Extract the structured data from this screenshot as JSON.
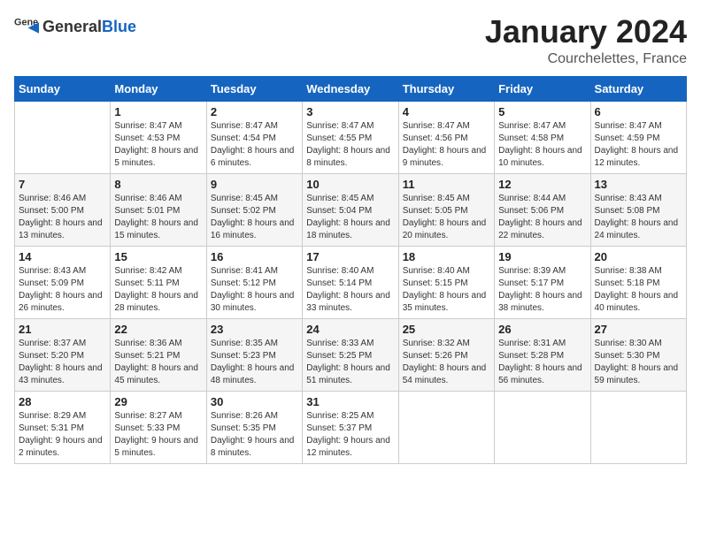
{
  "logo": {
    "general": "General",
    "blue": "Blue"
  },
  "title": {
    "month": "January 2024",
    "location": "Courchelettes, France"
  },
  "days_of_week": [
    "Sunday",
    "Monday",
    "Tuesday",
    "Wednesday",
    "Thursday",
    "Friday",
    "Saturday"
  ],
  "weeks": [
    [
      {
        "day": "",
        "sunrise": "",
        "sunset": "",
        "daylight": ""
      },
      {
        "day": "1",
        "sunrise": "Sunrise: 8:47 AM",
        "sunset": "Sunset: 4:53 PM",
        "daylight": "Daylight: 8 hours and 5 minutes."
      },
      {
        "day": "2",
        "sunrise": "Sunrise: 8:47 AM",
        "sunset": "Sunset: 4:54 PM",
        "daylight": "Daylight: 8 hours and 6 minutes."
      },
      {
        "day": "3",
        "sunrise": "Sunrise: 8:47 AM",
        "sunset": "Sunset: 4:55 PM",
        "daylight": "Daylight: 8 hours and 8 minutes."
      },
      {
        "day": "4",
        "sunrise": "Sunrise: 8:47 AM",
        "sunset": "Sunset: 4:56 PM",
        "daylight": "Daylight: 8 hours and 9 minutes."
      },
      {
        "day": "5",
        "sunrise": "Sunrise: 8:47 AM",
        "sunset": "Sunset: 4:58 PM",
        "daylight": "Daylight: 8 hours and 10 minutes."
      },
      {
        "day": "6",
        "sunrise": "Sunrise: 8:47 AM",
        "sunset": "Sunset: 4:59 PM",
        "daylight": "Daylight: 8 hours and 12 minutes."
      }
    ],
    [
      {
        "day": "7",
        "sunrise": "Sunrise: 8:46 AM",
        "sunset": "Sunset: 5:00 PM",
        "daylight": "Daylight: 8 hours and 13 minutes."
      },
      {
        "day": "8",
        "sunrise": "Sunrise: 8:46 AM",
        "sunset": "Sunset: 5:01 PM",
        "daylight": "Daylight: 8 hours and 15 minutes."
      },
      {
        "day": "9",
        "sunrise": "Sunrise: 8:45 AM",
        "sunset": "Sunset: 5:02 PM",
        "daylight": "Daylight: 8 hours and 16 minutes."
      },
      {
        "day": "10",
        "sunrise": "Sunrise: 8:45 AM",
        "sunset": "Sunset: 5:04 PM",
        "daylight": "Daylight: 8 hours and 18 minutes."
      },
      {
        "day": "11",
        "sunrise": "Sunrise: 8:45 AM",
        "sunset": "Sunset: 5:05 PM",
        "daylight": "Daylight: 8 hours and 20 minutes."
      },
      {
        "day": "12",
        "sunrise": "Sunrise: 8:44 AM",
        "sunset": "Sunset: 5:06 PM",
        "daylight": "Daylight: 8 hours and 22 minutes."
      },
      {
        "day": "13",
        "sunrise": "Sunrise: 8:43 AM",
        "sunset": "Sunset: 5:08 PM",
        "daylight": "Daylight: 8 hours and 24 minutes."
      }
    ],
    [
      {
        "day": "14",
        "sunrise": "Sunrise: 8:43 AM",
        "sunset": "Sunset: 5:09 PM",
        "daylight": "Daylight: 8 hours and 26 minutes."
      },
      {
        "day": "15",
        "sunrise": "Sunrise: 8:42 AM",
        "sunset": "Sunset: 5:11 PM",
        "daylight": "Daylight: 8 hours and 28 minutes."
      },
      {
        "day": "16",
        "sunrise": "Sunrise: 8:41 AM",
        "sunset": "Sunset: 5:12 PM",
        "daylight": "Daylight: 8 hours and 30 minutes."
      },
      {
        "day": "17",
        "sunrise": "Sunrise: 8:40 AM",
        "sunset": "Sunset: 5:14 PM",
        "daylight": "Daylight: 8 hours and 33 minutes."
      },
      {
        "day": "18",
        "sunrise": "Sunrise: 8:40 AM",
        "sunset": "Sunset: 5:15 PM",
        "daylight": "Daylight: 8 hours and 35 minutes."
      },
      {
        "day": "19",
        "sunrise": "Sunrise: 8:39 AM",
        "sunset": "Sunset: 5:17 PM",
        "daylight": "Daylight: 8 hours and 38 minutes."
      },
      {
        "day": "20",
        "sunrise": "Sunrise: 8:38 AM",
        "sunset": "Sunset: 5:18 PM",
        "daylight": "Daylight: 8 hours and 40 minutes."
      }
    ],
    [
      {
        "day": "21",
        "sunrise": "Sunrise: 8:37 AM",
        "sunset": "Sunset: 5:20 PM",
        "daylight": "Daylight: 8 hours and 43 minutes."
      },
      {
        "day": "22",
        "sunrise": "Sunrise: 8:36 AM",
        "sunset": "Sunset: 5:21 PM",
        "daylight": "Daylight: 8 hours and 45 minutes."
      },
      {
        "day": "23",
        "sunrise": "Sunrise: 8:35 AM",
        "sunset": "Sunset: 5:23 PM",
        "daylight": "Daylight: 8 hours and 48 minutes."
      },
      {
        "day": "24",
        "sunrise": "Sunrise: 8:33 AM",
        "sunset": "Sunset: 5:25 PM",
        "daylight": "Daylight: 8 hours and 51 minutes."
      },
      {
        "day": "25",
        "sunrise": "Sunrise: 8:32 AM",
        "sunset": "Sunset: 5:26 PM",
        "daylight": "Daylight: 8 hours and 54 minutes."
      },
      {
        "day": "26",
        "sunrise": "Sunrise: 8:31 AM",
        "sunset": "Sunset: 5:28 PM",
        "daylight": "Daylight: 8 hours and 56 minutes."
      },
      {
        "day": "27",
        "sunrise": "Sunrise: 8:30 AM",
        "sunset": "Sunset: 5:30 PM",
        "daylight": "Daylight: 8 hours and 59 minutes."
      }
    ],
    [
      {
        "day": "28",
        "sunrise": "Sunrise: 8:29 AM",
        "sunset": "Sunset: 5:31 PM",
        "daylight": "Daylight: 9 hours and 2 minutes."
      },
      {
        "day": "29",
        "sunrise": "Sunrise: 8:27 AM",
        "sunset": "Sunset: 5:33 PM",
        "daylight": "Daylight: 9 hours and 5 minutes."
      },
      {
        "day": "30",
        "sunrise": "Sunrise: 8:26 AM",
        "sunset": "Sunset: 5:35 PM",
        "daylight": "Daylight: 9 hours and 8 minutes."
      },
      {
        "day": "31",
        "sunrise": "Sunrise: 8:25 AM",
        "sunset": "Sunset: 5:37 PM",
        "daylight": "Daylight: 9 hours and 12 minutes."
      },
      {
        "day": "",
        "sunrise": "",
        "sunset": "",
        "daylight": ""
      },
      {
        "day": "",
        "sunrise": "",
        "sunset": "",
        "daylight": ""
      },
      {
        "day": "",
        "sunrise": "",
        "sunset": "",
        "daylight": ""
      }
    ]
  ]
}
